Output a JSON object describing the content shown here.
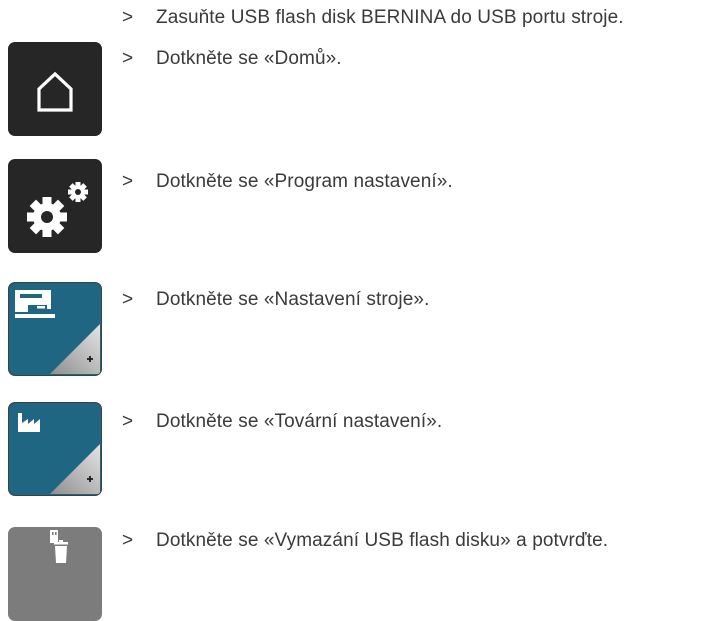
{
  "steps": [
    {
      "marker": ">",
      "text": "Zasuňte USB flash disk BERNINA do USB portu stroje."
    },
    {
      "marker": ">",
      "text": "Dotkněte se «Domů»."
    },
    {
      "marker": ">",
      "text": "Dotkněte se «Program nastavení»."
    },
    {
      "marker": ">",
      "text": "Dotkněte se «Nastavení stroje»."
    },
    {
      "marker": ">",
      "text": "Dotkněte se «Tovární nastavení»."
    },
    {
      "marker": ">",
      "text": "Dotkněte se «Vymazání USB flash disku» a potvrďte."
    }
  ],
  "icons": {
    "home": "home-icon",
    "setup": "gears-icon",
    "machine_settings": "sewing-machine-icon",
    "factory_settings": "factory-icon",
    "delete_usb": "usb-trash-icon"
  },
  "colors": {
    "dark_button": "#262626",
    "blue_button": "#1f6683",
    "gray_button": "#7c7c7c",
    "text": "#3a3a3a"
  }
}
